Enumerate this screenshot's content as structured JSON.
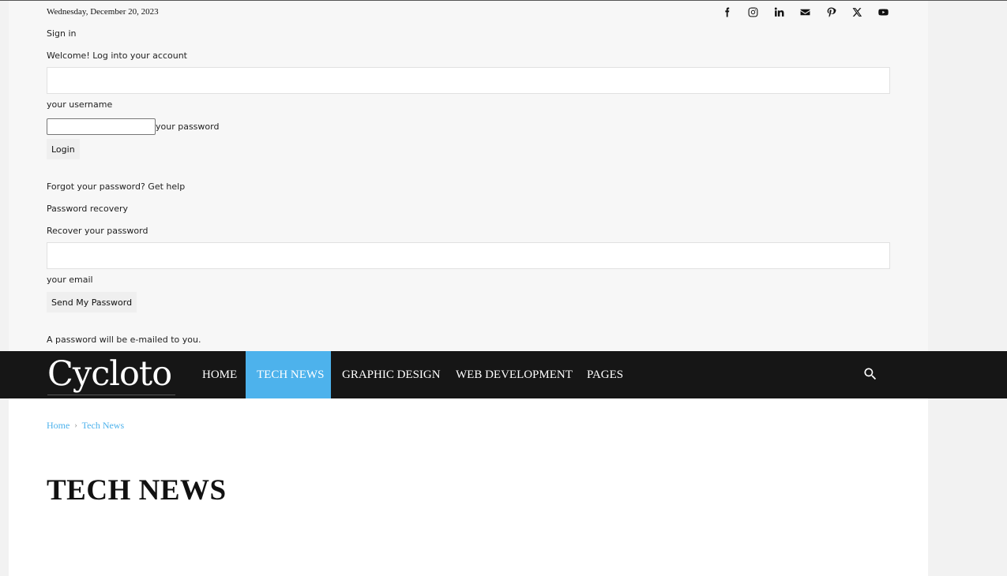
{
  "topbar": {
    "date": "Wednesday, December 20, 2023",
    "socials": [
      "facebook-icon",
      "instagram-icon",
      "linkedin-icon",
      "mail-icon",
      "pinterest-icon",
      "x-icon",
      "youtube-icon"
    ]
  },
  "login": {
    "title": "Sign in",
    "welcome": "Welcome! Log into your account",
    "username_value": "",
    "username_label": "your username",
    "password_value": "",
    "password_label": "your password",
    "login_button": "Login",
    "forgot": "Forgot your password? Get help"
  },
  "recovery": {
    "title": "Password recovery",
    "subtitle": "Recover your password",
    "email_value": "",
    "email_label": "your email",
    "send_button": "Send My Password",
    "note": "A password will be e-mailed to you."
  },
  "nav": {
    "logo": "Cycloto",
    "items": [
      "HOME",
      "TECH NEWS",
      "GRAPHIC DESIGN",
      "WEB DEVELOPMENT",
      "PAGES"
    ],
    "active_index": 1
  },
  "breadcrumb": {
    "home": "Home",
    "separator": "›",
    "current": "Tech News"
  },
  "page": {
    "title": "TECH NEWS"
  },
  "colors": {
    "accent": "#4db2ec",
    "nav_bg": "#161616"
  }
}
